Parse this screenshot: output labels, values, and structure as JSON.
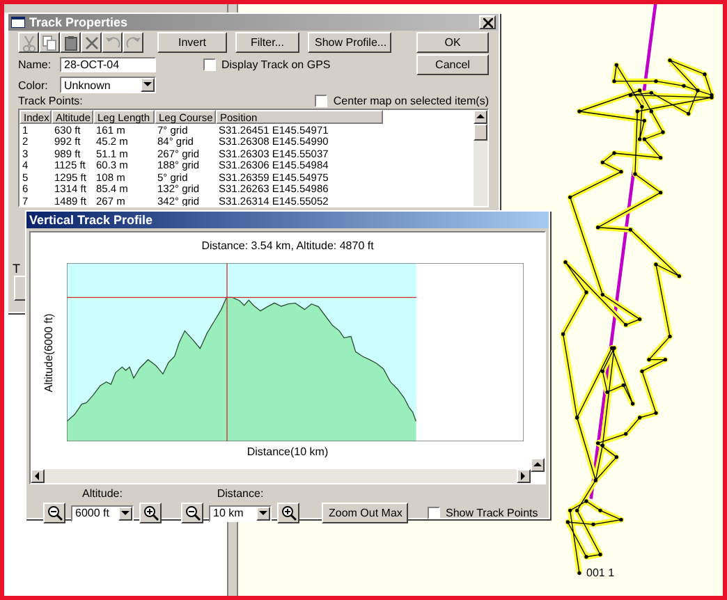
{
  "track_properties": {
    "title": "Track Properties",
    "buttons": [
      "Invert",
      "Filter...",
      "Show Profile..."
    ],
    "ok": "OK",
    "cancel": "Cancel",
    "name_label": "Name:",
    "name_value": "28-OCT-04",
    "display_on_gps": {
      "label": "Display Track on GPS",
      "checked": false
    },
    "color_label": "Color:",
    "color_value": "Unknown",
    "track_points_label": "Track Points:",
    "center_map": {
      "label": "Center map on selected item(s)",
      "checked": false
    },
    "columns": [
      "Index",
      "Altitude",
      "Leg Length",
      "Leg Course",
      "Position"
    ],
    "rows": [
      [
        "1",
        "630 ft",
        "161 m",
        "7° grid",
        "S31.26451 E145.54971"
      ],
      [
        "2",
        "992 ft",
        "45.2 m",
        "84° grid",
        "S31.26308 E145.54990"
      ],
      [
        "3",
        "989 ft",
        "51.1 m",
        "267° grid",
        "S31.26303 E145.55037"
      ],
      [
        "4",
        "1125 ft",
        "60.3 m",
        "188° grid",
        "S31.26306 E145.54984"
      ],
      [
        "5",
        "1295 ft",
        "108 m",
        "5° grid",
        "S31.26359 E145.54975"
      ],
      [
        "6",
        "1314 ft",
        "85.4 m",
        "132° grid",
        "S31.26263 E145.54986"
      ],
      [
        "7",
        "1489 ft",
        "267 m",
        "342° grid",
        "S31.26314 E145.55052"
      ]
    ],
    "hidden_label": "T"
  },
  "profile": {
    "title": "Vertical Track Profile",
    "readout": "Distance: 3.54 km, Altitude: 4870 ft",
    "y_axis_label": "Altitude(6000 ft)",
    "x_axis_label": "Distance(10 km)",
    "altitude_label": "Altitude:",
    "altitude_value": "6000 ft",
    "distance_label": "Distance:",
    "distance_value": "10 km",
    "zoom_out_max": "Zoom Out Max",
    "show_track_points": {
      "label": "Show Track Points",
      "checked": false
    }
  },
  "map": {
    "waypoint_label": "001 1"
  }
}
